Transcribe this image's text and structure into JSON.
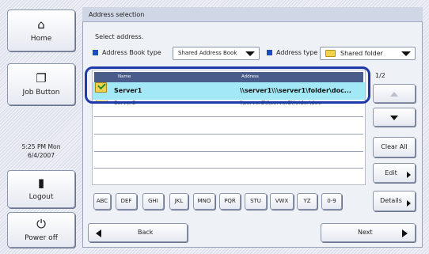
{
  "sidebar": {
    "home": "Home",
    "job_button": "Job Button",
    "time": "5:25 PM  Mon",
    "date": "6/4/2007",
    "logout": "Logout",
    "power_off": "Power off"
  },
  "window_title": "Address selection",
  "instruction": "Select address.",
  "filters": {
    "book_type_label": "Address Book type",
    "book_type_value": "Shared Address Book",
    "address_type_label": "Address type",
    "address_type_value": "Shared folder"
  },
  "list": {
    "columns": [
      "Name",
      "Address"
    ],
    "rows": [
      {
        "name": "Server1",
        "address": "\\\\server1\\\\\\server1\\folder\\doc...",
        "selected": true
      },
      {
        "name": "Server2",
        "address": "\\\\server2\\\\\\server2\\folder\\doc",
        "selected": false
      }
    ]
  },
  "pagination": "1/2",
  "buttons": {
    "clear_all": "Clear All",
    "edit": "Edit",
    "details": "Details",
    "back": "Back",
    "next": "Next"
  },
  "alphabet": [
    "ABC",
    "DEF",
    "GHI",
    "JKL",
    "MNO",
    "PQR",
    "STU",
    "VWX",
    "YZ",
    "0-9"
  ],
  "colors": {
    "selection": "#a3e8f6",
    "highlight_ring": "#1d3aa8",
    "header": "#4a5d8a",
    "accent_square": "#1c4fbd"
  },
  "icons": {
    "home": "home-icon",
    "job": "job-icon",
    "logout": "logout-icon",
    "power": "power-icon",
    "folder": "folder-icon",
    "selected": "folder-check-icon"
  }
}
